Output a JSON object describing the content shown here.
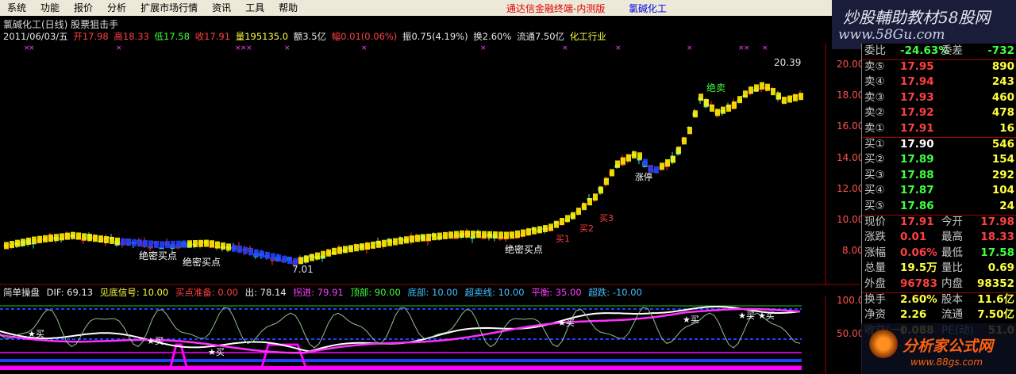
{
  "menu": [
    "系统",
    "功能",
    "报价",
    "分析",
    "扩展市场行情",
    "资讯",
    "工具",
    "帮助"
  ],
  "title_red": "通达信金融终端-内测版",
  "title_blue": "氯碱化工",
  "brand": {
    "line1": "炒股輔助教材58股网",
    "line2": "www.58Gu.com"
  },
  "info1": "氯碱化工(日线) 股票狙击手",
  "info2": {
    "date": "2011/06/03/五",
    "open": "开17.98",
    "high": "高18.33",
    "low": "低17.58",
    "close": "收17.91",
    "vol": "量195135.0",
    "amt": "额3.5亿",
    "chg": "幅0.01(0.06%)",
    "amp": "振0.75(4.19%)",
    "turn": "换2.60%",
    "float": "流通7.50亿",
    "sector": "化工行业"
  },
  "yaxis": [
    "20.00",
    "18.00",
    "16.00",
    "14.00",
    "12.00",
    "10.00",
    "8.00",
    "100.0",
    "50.00"
  ],
  "price_label_high": "20.39",
  "price_label_low": "7.01",
  "main_labels": {
    "jdmd1": "绝密买点",
    "jdmd2": "绝密买点",
    "jdmd3": "绝密买点",
    "jm": "绝卖",
    "buy1": "买1",
    "buy2": "买2",
    "buy3": "买3",
    "zt": "涨停"
  },
  "subhead": {
    "name": "简单操盘",
    "dif": "DIF: 69.13",
    "jdxh": "见底信号: 10.00",
    "mdzb": "买点准备: 0.00",
    "bc": "出: 78.14",
    "fj": "拐进: 79.91",
    "db": "顶部: 90.00",
    "dbl": "底部: 10.00",
    "cmx": "超卖线: 10.00",
    "ph": "平衡: 35.00",
    "ht": "超跌: -10.00"
  },
  "sub_buy": "买",
  "quote": {
    "top": {
      "l": "委比",
      "p": "-24.63%",
      "l2": "委差",
      "v2": "-732"
    },
    "sells": [
      {
        "l": "卖⑤",
        "p": "17.95",
        "v": "890"
      },
      {
        "l": "卖④",
        "p": "17.94",
        "v": "243"
      },
      {
        "l": "卖③",
        "p": "17.93",
        "v": "460"
      },
      {
        "l": "卖②",
        "p": "17.92",
        "v": "478"
      },
      {
        "l": "卖①",
        "p": "17.91",
        "v": "16"
      }
    ],
    "buys": [
      {
        "l": "买①",
        "p": "17.90",
        "v": "546"
      },
      {
        "l": "买②",
        "p": "17.89",
        "v": "154"
      },
      {
        "l": "买③",
        "p": "17.88",
        "v": "292"
      },
      {
        "l": "买④",
        "p": "17.87",
        "v": "104"
      },
      {
        "l": "买⑤",
        "p": "17.86",
        "v": "24"
      }
    ],
    "stats": [
      {
        "l": "现价",
        "p": "17.91",
        "l2": "今开",
        "v2": "17.98"
      },
      {
        "l": "涨跌",
        "p": "0.01",
        "l2": "最高",
        "v2": "18.33"
      },
      {
        "l": "涨幅",
        "p": "0.06%",
        "l2": "最低",
        "v2": "17.58"
      },
      {
        "l": "总量",
        "p": "19.5万",
        "l2": "量比",
        "v2": "0.69"
      },
      {
        "l": "外盘",
        "p": "96783",
        "l2": "内盘",
        "v2": "98352"
      }
    ],
    "stats2": [
      {
        "l": "换手",
        "p": "2.60%",
        "l2": "股本",
        "v2": "11.6亿"
      },
      {
        "l": "净资",
        "p": "2.26",
        "l2": "流通",
        "v2": "7.50亿"
      },
      {
        "l": "收益(一)",
        "p": "0.088",
        "l2": "PE(动)",
        "v2": "51.0"
      }
    ]
  },
  "watermark": {
    "line1": "分析家公式网",
    "line2": "www.88gs.com"
  }
}
